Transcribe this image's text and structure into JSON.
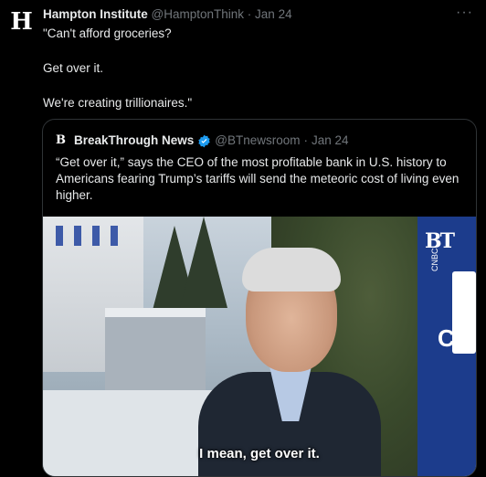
{
  "tweet": {
    "author_name": "Hampton Institute",
    "author_handle": "@HamptonThink",
    "separator": "·",
    "date": "Jan 24",
    "avatar_letter": "H",
    "lines": [
      "\"Can't afford groceries?",
      "Get over it.",
      "We're creating trillionaires.\""
    ]
  },
  "quoted": {
    "author_name": "BreakThrough News",
    "author_handle": "@BTnewsroom",
    "separator": "·",
    "date": "Jan 24",
    "text": "“Get over it,” says the CEO of the most profitable bank in U.S. history to Americans fearing Trump’s tariffs will send the meteoric cost of living even higher.",
    "media": {
      "caption": "I mean, get over it.",
      "watermark": "BT",
      "network_label": "CNBC",
      "network_partial": "CI"
    }
  },
  "colors": {
    "background": "#000000",
    "text": "#e7e9ea",
    "muted": "#71767b",
    "verified": "#1d9bf0"
  }
}
